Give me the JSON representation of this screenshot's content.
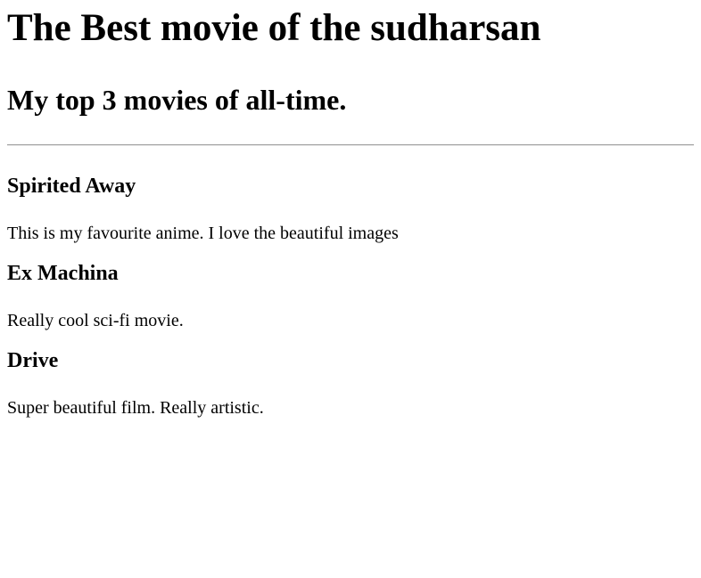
{
  "page": {
    "title": "The Best movie of the sudharsan",
    "subtitle": "My top 3 movies of all-time."
  },
  "movies": [
    {
      "title": "Spirited Away",
      "description": "This is my favourite anime. I love the beautiful images"
    },
    {
      "title": "Ex Machina",
      "description": "Really cool sci-fi movie."
    },
    {
      "title": "Drive",
      "description": "Super beautiful film. Really artistic."
    }
  ]
}
